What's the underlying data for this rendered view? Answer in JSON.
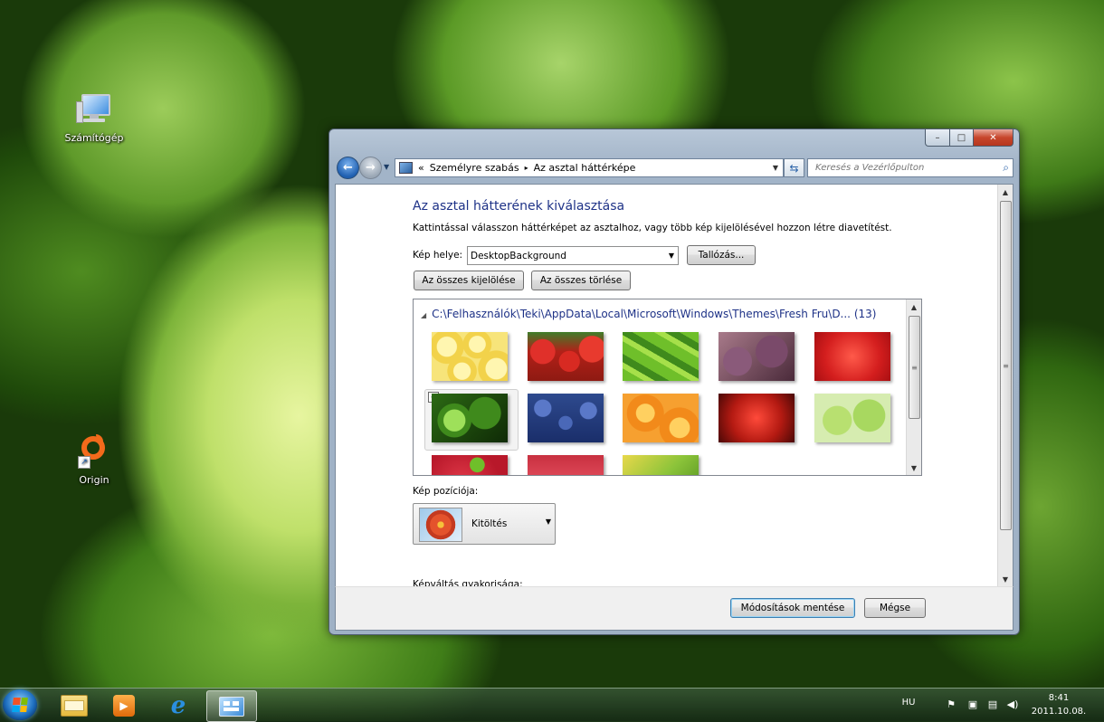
{
  "desktop": {
    "icons": [
      {
        "label": "Számítógép",
        "icon": "computer-icon"
      },
      {
        "label": "Origin",
        "icon": "origin-icon"
      }
    ]
  },
  "window": {
    "caption_buttons": {
      "minimize": "–",
      "maximize": "□",
      "close": "✕"
    },
    "address": {
      "prefix": "«",
      "crumbs": [
        "Személyre szabás",
        "Az asztal háttérképe"
      ],
      "separator": "▸"
    },
    "search": {
      "placeholder": "Keresés a Vezérlőpulton"
    },
    "title": "Az asztal hátterének kiválasztása",
    "description": "Kattintással válasszon háttérképet az asztalhoz, vagy több kép kijelölésével hozzon létre diavetítést.",
    "location": {
      "label": "Kép helye:",
      "value": "DesktopBackground",
      "browse": "Tallózás..."
    },
    "select_all": "Az összes kijelölése",
    "clear_all": "Az összes törlése",
    "gallery": {
      "group_title": "C:\\Felhasználók\\Teki\\AppData\\Local\\Microsoft\\Windows\\Themes\\Fresh Fru\\D... (13)",
      "images": [
        {
          "name": "lemon-slices",
          "checked": false
        },
        {
          "name": "strawberries",
          "checked": false
        },
        {
          "name": "star-fruit",
          "checked": false
        },
        {
          "name": "figs",
          "checked": false
        },
        {
          "name": "raspberries-close",
          "checked": false
        },
        {
          "name": "limes",
          "checked": true,
          "check_mark": "✓"
        },
        {
          "name": "blueberries",
          "checked": false
        },
        {
          "name": "orange-slices",
          "checked": false
        },
        {
          "name": "pomegranate",
          "checked": false
        },
        {
          "name": "green-apples",
          "checked": false
        },
        {
          "name": "raspberries",
          "checked": false
        },
        {
          "name": "cherries",
          "checked": false
        },
        {
          "name": "mixed-fruit",
          "checked": false
        }
      ]
    },
    "position": {
      "label": "Kép pozíciója:",
      "value": "Kitöltés"
    },
    "frequency_label": "Képváltás gyakorisága:",
    "save_button": "Módosítások mentése",
    "cancel_button": "Mégse"
  },
  "taskbar": {
    "apps": [
      "windows-explorer-icon",
      "media-player-icon",
      "internet-explorer-icon",
      "control-panel-icon"
    ],
    "language": "HU",
    "time": "8:41",
    "date": "2011.10.08."
  }
}
